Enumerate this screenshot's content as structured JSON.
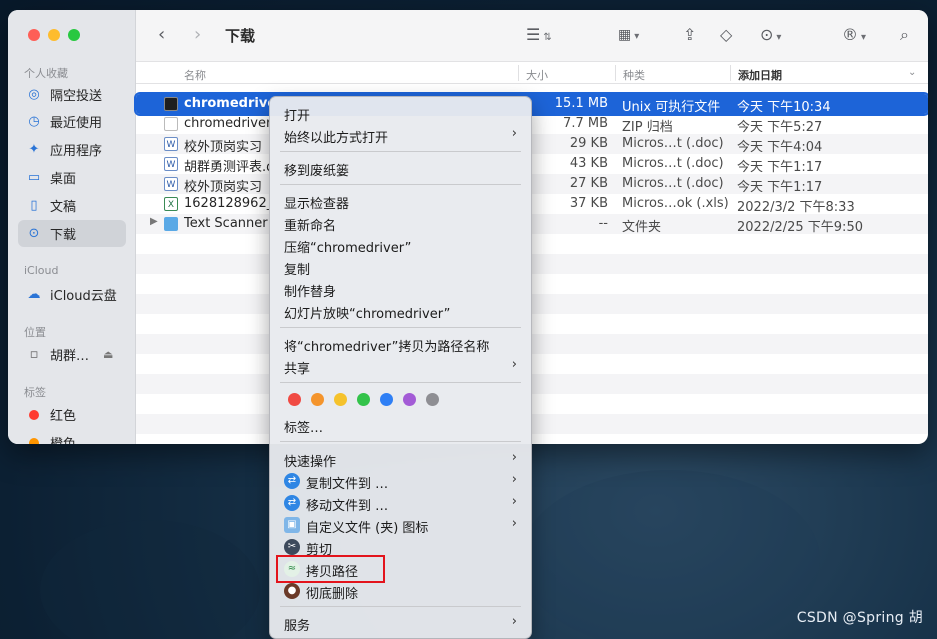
{
  "window": {
    "title": "下载",
    "sidebar": {
      "favorites_title": "个人收藏",
      "favorites": [
        {
          "label": "隔空投送",
          "icon": "airdrop-icon"
        },
        {
          "label": "最近使用",
          "icon": "clock-icon"
        },
        {
          "label": "应用程序",
          "icon": "applications-icon"
        },
        {
          "label": "桌面",
          "icon": "desktop-icon"
        },
        {
          "label": "文稿",
          "icon": "document-icon"
        },
        {
          "label": "下载",
          "icon": "download-icon",
          "active": true
        }
      ],
      "icloud_title": "iCloud",
      "icloud_items": [
        {
          "label": "iCloud云盘",
          "icon": "cloud-icon"
        }
      ],
      "locations_title": "位置",
      "locations": [
        {
          "label": "胡群…",
          "icon": "disk-icon"
        }
      ],
      "tags_title": "标签",
      "tags": [
        {
          "label": "红色",
          "color": "#ff3b30"
        },
        {
          "label": "橙色",
          "color": "#ff9500"
        }
      ]
    },
    "columns": {
      "name": "名称",
      "size": "大小",
      "kind": "种类",
      "date": "添加日期"
    },
    "files": [
      {
        "name": "chromedriver",
        "size": "15.1 MB",
        "kind": "Unix 可执行文件",
        "date": "今天 下午10:34",
        "icon": "exe",
        "selected": true
      },
      {
        "name": "chromedriver_",
        "size": "7.7 MB",
        "kind": "ZIP 归档",
        "date": "今天 下午5:27",
        "icon": "zip"
      },
      {
        "name": "校外顶岗实习",
        "size": "29 KB",
        "kind": "Micros…t (.doc)",
        "date": "今天 下午4:04",
        "icon": "doc"
      },
      {
        "name": "胡群勇测评表.d",
        "size": "43 KB",
        "kind": "Micros…t (.doc)",
        "date": "今天 下午1:17",
        "icon": "doc"
      },
      {
        "name": "校外顶岗实习",
        "size": "27 KB",
        "kind": "Micros…t (.doc)",
        "date": "今天 下午1:17",
        "icon": "doc"
      },
      {
        "name": "1628128962_",
        "size": "37 KB",
        "kind": "Micros…ok (.xls)",
        "date": "2022/3/2 下午8:33",
        "icon": "xls"
      },
      {
        "name": "Text Scanner",
        "size": "--",
        "kind": "文件夹",
        "date": "2022/2/25 下午9:50",
        "icon": "folder"
      }
    ]
  },
  "menu": {
    "open": "打开",
    "open_with": "始终以此方式打开",
    "trash": "移到废纸篓",
    "get_info": "显示检查器",
    "rename": "重新命名",
    "compress": "压缩“chromedriver”",
    "duplicate": "复制",
    "make_alias": "制作替身",
    "slideshow": "幻灯片放映“chromedriver”",
    "copy_path_as": "将“chromedriver”拷贝为路径名称",
    "share": "共享",
    "tag_colors": [
      "#f04a43",
      "#f4942c",
      "#f5c22c",
      "#33c34a",
      "#2f7ff5",
      "#a35bd6",
      "#8e8e93"
    ],
    "tags": "标签…",
    "quick_actions": "快速操作",
    "copy_files_to": "复制文件到 …",
    "move_files_to": "移动文件到 …",
    "custom_icon": "自定义文件 (夹) 图标",
    "cut": "剪切",
    "copy_path": "拷贝路径",
    "delete_permanently": "彻底删除",
    "services": "服务"
  },
  "watermark": "CSDN @Spring 胡"
}
